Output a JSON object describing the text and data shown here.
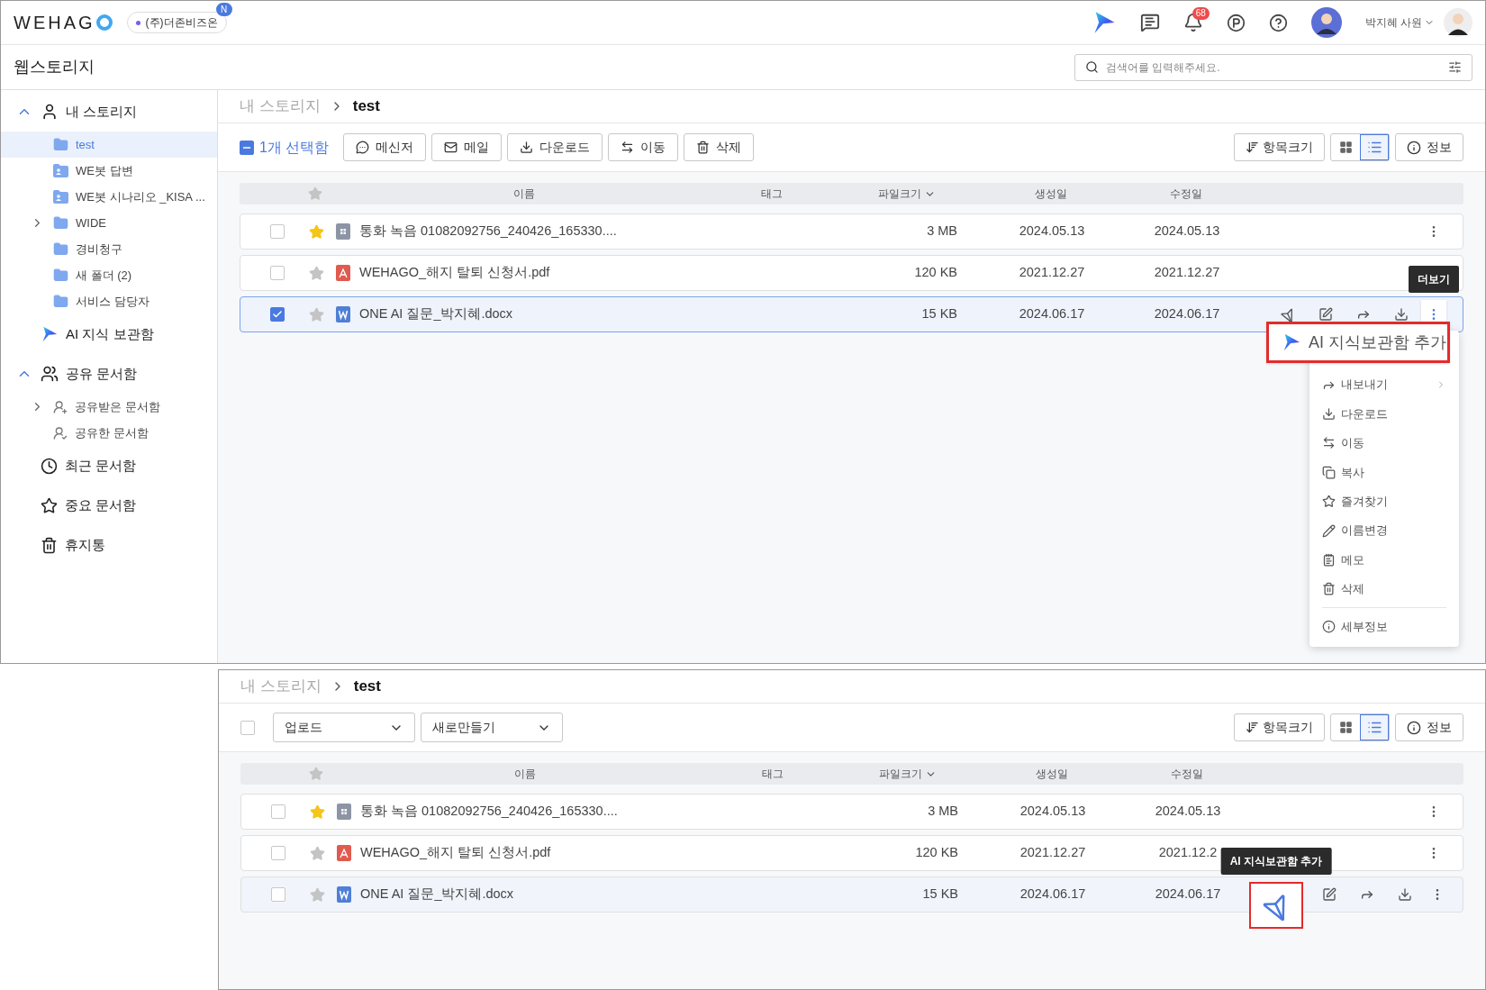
{
  "header": {
    "logo": "WEHAG",
    "company": "(주)더존비즈온",
    "company_badge": "N",
    "notification_count": "68",
    "user_name": "박지혜 사원"
  },
  "page_title": "웹스토리지",
  "search": {
    "placeholder": "검색어를 입력해주세요."
  },
  "sidebar": {
    "items": [
      {
        "label": "내 스토리지",
        "kind": "user",
        "expanded": true,
        "selected": false,
        "children": [
          {
            "label": "test",
            "kind": "folder",
            "selected": true
          },
          {
            "label": "WE봇 답변",
            "kind": "shared-folder",
            "selected": false
          },
          {
            "label": "WE봇 시나리오 _KISA ...",
            "kind": "shared-folder",
            "selected": false
          },
          {
            "label": "WIDE",
            "kind": "folder",
            "expanded": false,
            "selected": false
          },
          {
            "label": "경비청구",
            "kind": "folder",
            "selected": false
          },
          {
            "label": "새 폴더 (2)",
            "kind": "folder",
            "selected": false
          },
          {
            "label": "서비스 담당자",
            "kind": "folder",
            "selected": false
          }
        ]
      },
      {
        "label": "AI 지식 보관함",
        "kind": "ai",
        "selected": false
      },
      {
        "label": "공유 문서함",
        "kind": "users",
        "expanded": true,
        "selected": false,
        "children": [
          {
            "label": "공유받은 문서함",
            "kind": "shared-in",
            "expanded": false,
            "selected": false
          },
          {
            "label": "공유한 문서함",
            "kind": "shared-out",
            "selected": false
          }
        ]
      },
      {
        "label": "최근 문서함",
        "kind": "clock",
        "selected": false
      },
      {
        "label": "중요 문서함",
        "kind": "star",
        "selected": false
      },
      {
        "label": "휴지통",
        "kind": "trash",
        "selected": false
      }
    ]
  },
  "views": [
    {
      "breadcrumb": [
        "내 스토리지",
        "test"
      ],
      "toolbar": {
        "kind": "selection",
        "select_all": {
          "partial": true
        },
        "selection_label": "1개 선택함",
        "actions": [
          {
            "label": "메신저",
            "kind": "messenger"
          },
          {
            "label": "메일",
            "kind": "mail"
          },
          {
            "label": "다운로드",
            "kind": "download"
          },
          {
            "label": "이동",
            "kind": "move"
          },
          {
            "label": "삭제",
            "kind": "delete"
          }
        ]
      },
      "item_size_label": "항목크기",
      "view_modes": [
        {
          "kind": "grid",
          "selected": false
        },
        {
          "kind": "list",
          "selected": true
        }
      ],
      "info_label": "정보",
      "columns": [
        "이름",
        "태그",
        "파일크기",
        "생성일",
        "수정일"
      ],
      "rows": [
        {
          "checked": false,
          "starred": true,
          "kind": "audio",
          "name": "통화 녹음 01082092756_240426_165330....",
          "size": "3 MB",
          "created": "2024.05.13",
          "modified": "2024.05.13",
          "hovered": false
        },
        {
          "checked": false,
          "starred": false,
          "kind": "pdf",
          "name": "WEHAGO_해지 탈퇴 신청서.pdf",
          "size": "120 KB",
          "created": "2021.12.27",
          "modified": "2021.12.27",
          "hovered": false
        },
        {
          "checked": true,
          "starred": false,
          "kind": "word",
          "name": "ONE AI 질문_박지혜.docx",
          "size": "15 KB",
          "created": "2024.06.17",
          "modified": "2024.06.17",
          "hovered": true
        }
      ],
      "tooltip": {
        "text": "더보기",
        "kind": "more"
      },
      "context_menu": {
        "callout": "AI 지식보관함 추가",
        "items": [
          {
            "label": "내보내기",
            "kind": "export"
          },
          {
            "label": "다운로드",
            "kind": "download"
          },
          {
            "label": "이동",
            "kind": "move"
          },
          {
            "label": "복사",
            "kind": "copy"
          },
          {
            "label": "즐겨찾기",
            "kind": "favorite"
          },
          {
            "label": "이름변경",
            "kind": "rename"
          },
          {
            "label": "메모",
            "kind": "memo"
          },
          {
            "label": "삭제",
            "kind": "delete"
          },
          {
            "label": "세부정보",
            "kind": "info"
          }
        ]
      }
    },
    {
      "breadcrumb": [
        "내 스토리지",
        "test"
      ],
      "toolbar": {
        "kind": "upload",
        "select_all": {
          "partial": false
        },
        "dropdowns": [
          "업로드",
          "새로만들기"
        ]
      },
      "item_size_label": "항목크기",
      "view_modes": [
        {
          "kind": "grid",
          "selected": false
        },
        {
          "kind": "list",
          "selected": true
        }
      ],
      "info_label": "정보",
      "columns": [
        "이름",
        "태그",
        "파일크기",
        "생성일",
        "수정일"
      ],
      "rows": [
        {
          "checked": false,
          "starred": true,
          "kind": "audio",
          "name": "통화 녹음 01082092756_240426_165330....",
          "size": "3 MB",
          "created": "2024.05.13",
          "modified": "2024.05.13",
          "hovered": false
        },
        {
          "checked": false,
          "starred": false,
          "kind": "pdf",
          "name": "WEHAGO_해지 탈퇴 신청서.pdf",
          "size": "120 KB",
          "created": "2021.12.27",
          "modified": "2021.12.2",
          "hovered": false
        },
        {
          "checked": false,
          "starred": false,
          "kind": "word",
          "name": "ONE AI 질문_박지혜.docx",
          "size": "15 KB",
          "created": "2024.06.17",
          "modified": "2024.06.17",
          "hovered": true
        }
      ],
      "tooltip": {
        "text": "AI 지식보관함 추가",
        "kind": "ai"
      }
    }
  ]
}
